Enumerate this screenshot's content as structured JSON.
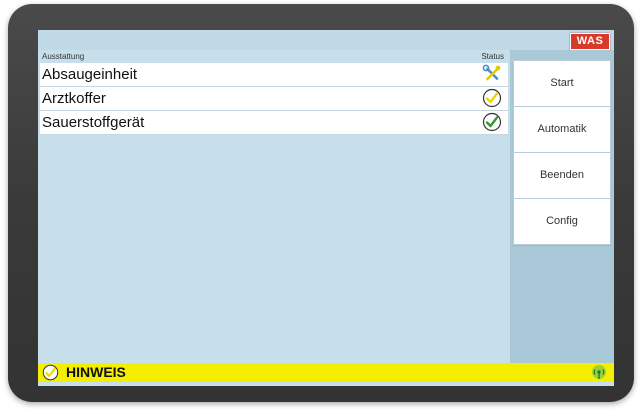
{
  "logo": {
    "text": "WAS"
  },
  "table": {
    "header_name": "Ausstattung",
    "header_status": "Status",
    "rows": [
      {
        "name": "Absaugeinheit",
        "status_icon": "tools-icon"
      },
      {
        "name": "Arztkoffer",
        "status_icon": "check-yellow-icon"
      },
      {
        "name": "Sauerstoffgerät",
        "status_icon": "check-green-icon"
      }
    ]
  },
  "sidebar": {
    "buttons": [
      "Start",
      "Automatik",
      "Beenden",
      "Config"
    ]
  },
  "status_bar": {
    "label": "HINWEIS",
    "left_icon": "check-yellow-icon",
    "right_icon": "signal-icon"
  },
  "colors": {
    "screen_bg": "#c7dfea",
    "sidebar_bg": "#a9c8d8",
    "status_bar_bg": "#f4ee00",
    "logo_bg": "#d63a2a",
    "check_green": "#2e9b2e",
    "check_yellow": "#f2d500"
  }
}
